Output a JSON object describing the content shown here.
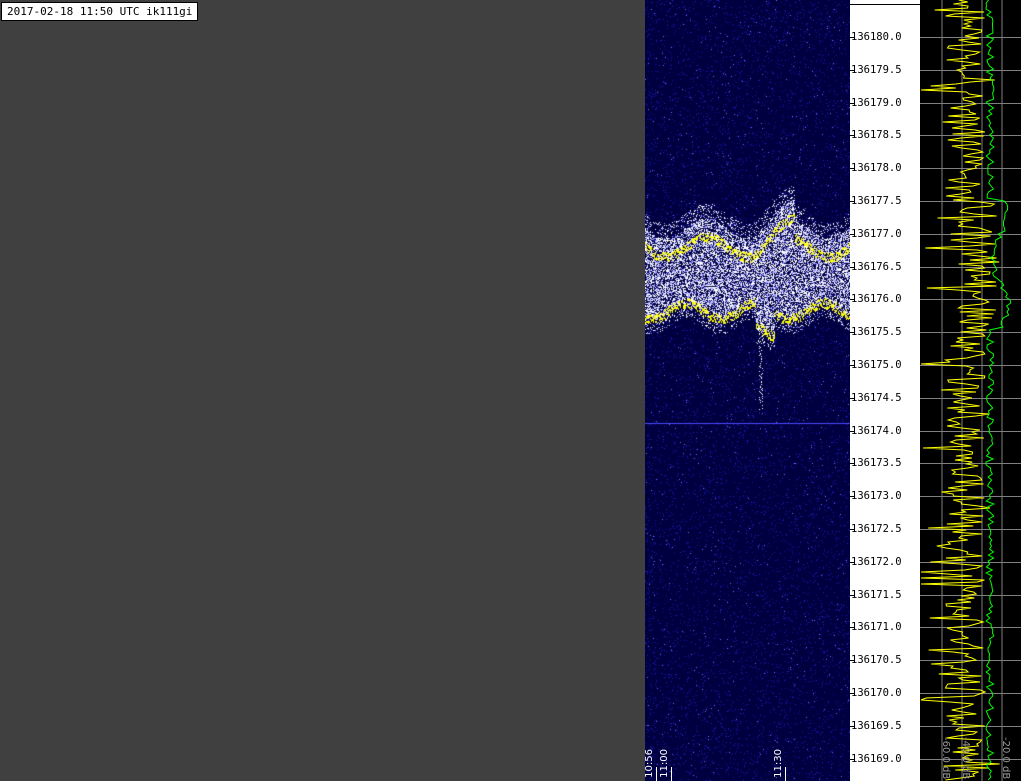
{
  "header": {
    "title": "2017-02-18 11:50 UTC ik111gi"
  },
  "waterfall": {
    "time_labels": [
      {
        "label": "10:56",
        "minute": 0
      },
      {
        "label": "11:00",
        "minute": 4
      },
      {
        "label": "11:30",
        "minute": 34
      }
    ],
    "minutes_span": 54,
    "colors": {
      "background": "#000040",
      "noise": "#2020c0",
      "signal": "#ffffff",
      "peak": "#ffff00"
    }
  },
  "frequency_scale": {
    "labels": [
      "136180.0",
      "136179.5",
      "136179.0",
      "136178.5",
      "136178.0",
      "136177.5",
      "136177.0",
      "136176.5",
      "136176.0",
      "136175.5",
      "136175.0",
      "136174.5",
      "136174.0",
      "136173.5",
      "136173.0",
      "136172.5",
      "136172.0",
      "136171.5",
      "136171.0",
      "136170.5",
      "136170.0",
      "136169.5",
      "136169.0"
    ],
    "top_value": 136180.0,
    "step": 0.5
  },
  "spectrum": {
    "db_labels": [
      {
        "label": "-60.0 dB",
        "side": "left"
      },
      {
        "label": "-40.0 dB",
        "side": "middle"
      },
      {
        "label": "-20.0 dB",
        "side": "right"
      }
    ],
    "colors": {
      "grid": "#808080",
      "instant": "#ffff00",
      "average": "#00ff00"
    }
  }
}
